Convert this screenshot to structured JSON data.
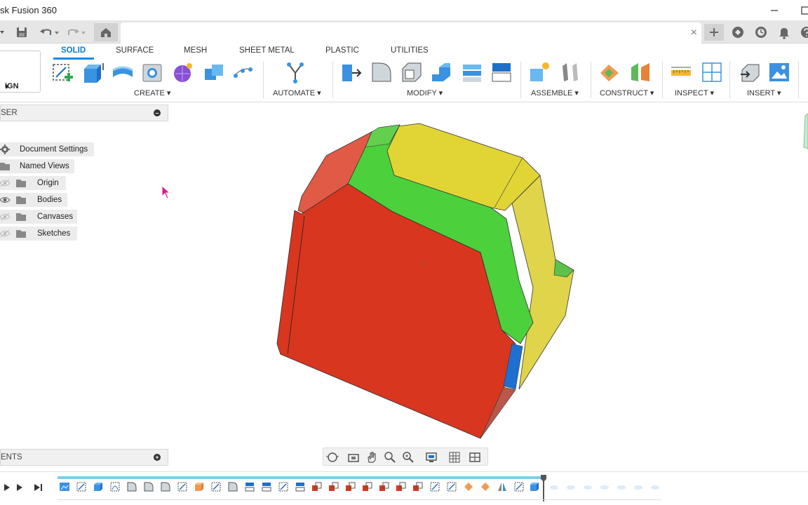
{
  "window": {
    "title": "sk Fusion 360",
    "minimize_icon": "minimize-icon",
    "maximize_icon": "maximize-icon"
  },
  "quick_access": {
    "icons": [
      "file-menu-icon",
      "save-icon",
      "undo-icon",
      "redo-icon",
      "home-icon"
    ]
  },
  "document_tab": {
    "title": "",
    "close_symbol": "×"
  },
  "right_icons": [
    "new-tab-icon",
    "extensions-icon",
    "job-status-icon",
    "notifications-icon",
    "help-icon"
  ],
  "workspace": {
    "label": "IGN",
    "arrow": "▾"
  },
  "tabs": [
    {
      "label": "SOLID",
      "active": true
    },
    {
      "label": "SURFACE",
      "active": false
    },
    {
      "label": "MESH",
      "active": false
    },
    {
      "label": "SHEET METAL",
      "active": false
    },
    {
      "label": "PLASTIC",
      "active": false
    },
    {
      "label": "UTILITIES",
      "active": false
    }
  ],
  "groups": {
    "create": "CREATE ▾",
    "automate": "AUTOMATE ▾",
    "modify": "MODIFY ▾",
    "assemble": "ASSEMBLE ▾",
    "construct": "CONSTRUCT ▾",
    "inspect": "INSPECT ▾",
    "insert": "INSERT ▾"
  },
  "browser": {
    "header": "SER",
    "items": [
      {
        "label": "Document Settings",
        "icon": "gear-icon"
      },
      {
        "label": "Named Views",
        "icon": "folder-icon"
      },
      {
        "label": "Origin",
        "icon": "folder-icon"
      },
      {
        "label": "Bodies",
        "icon": "folder-icon"
      },
      {
        "label": "Canvases",
        "icon": "folder-icon"
      },
      {
        "label": "Sketches",
        "icon": "folder-icon"
      }
    ]
  },
  "comments": {
    "header": "ENTS"
  },
  "colors": {
    "accent": "#1e88e5",
    "face_red": "#d9361f",
    "face_green": "#4cd03b",
    "face_yellow": "#e1d535",
    "face_blue": "#1f6fd1",
    "timeline_track": "#7ccfe9"
  }
}
